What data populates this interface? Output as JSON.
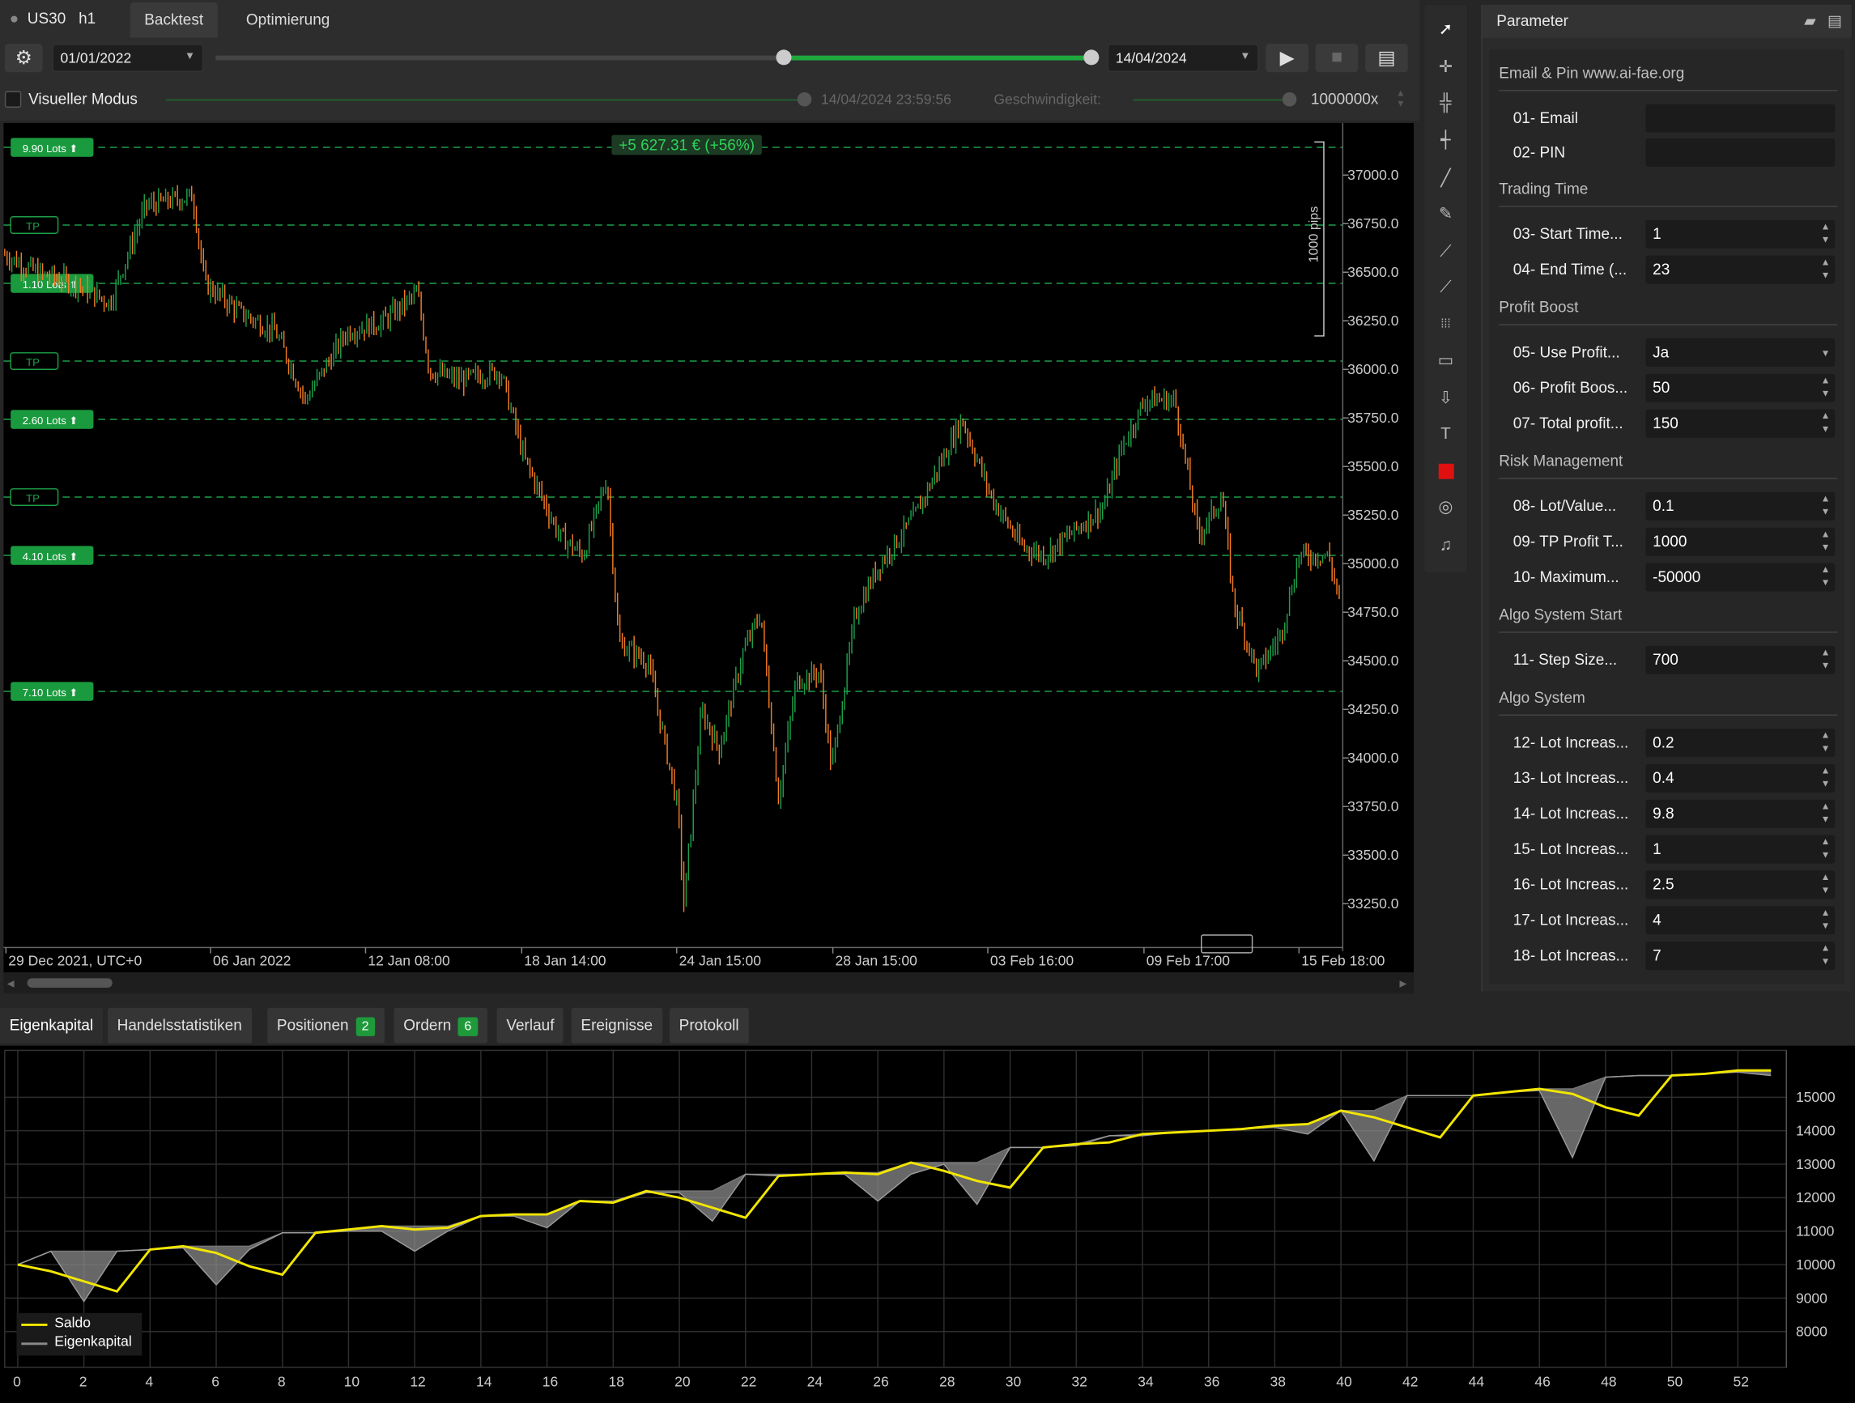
{
  "header": {
    "symbol": "US30",
    "timeframe": "h1",
    "tabs": [
      "Backtest",
      "Optimierung"
    ],
    "active_tab": "Backtest"
  },
  "controls": {
    "start_date": "01/01/2022",
    "end_date": "14/04/2024",
    "progress": 1.0
  },
  "visual": {
    "label": "Visueller Modus",
    "timestamp": "14/04/2024 23:59:56",
    "speed_label": "Geschwindigkeit:",
    "speed_value": "1000000x"
  },
  "chart": {
    "profit_label": "+5 627.31 € (+56%)",
    "pips_label": "1000 pips",
    "price_ticks": [
      "37000.0",
      "36750.0",
      "36500.0",
      "36250.0",
      "36000.0",
      "35750.0",
      "35500.0",
      "35250.0",
      "35000.0",
      "34750.0",
      "34500.0",
      "34250.0",
      "34000.0",
      "33750.0",
      "33500.0",
      "33250.0"
    ],
    "time_ticks": [
      "29 Dec 2021, UTC+0",
      "06 Jan 2022",
      "12 Jan 08:00",
      "18 Jan 14:00",
      "24 Jan 15:00",
      "28 Jan 15:00",
      "03 Feb 16:00",
      "09 Feb 17:00",
      "15 Feb 18:00"
    ],
    "levels": [
      {
        "label": "9.90 Lots ⬆",
        "type": "lot",
        "price": 37100
      },
      {
        "label": "TP",
        "type": "tp",
        "price": 36700
      },
      {
        "label": "1.10 Lots ⬆",
        "type": "lot",
        "price": 36400
      },
      {
        "label": "TP",
        "type": "tp",
        "price": 36000
      },
      {
        "label": "2.60 Lots ⬆",
        "type": "lot",
        "price": 35700
      },
      {
        "label": "TP",
        "type": "tp",
        "price": 35300
      },
      {
        "label": "4.10 Lots ⬆",
        "type": "lot",
        "price": 35000
      },
      {
        "label": "7.10 Lots ⬆",
        "type": "lot",
        "price": 34300
      }
    ],
    "up_color": "#1e9e4a",
    "down_color": "#f07b24"
  },
  "parameter": {
    "title": "Parameter",
    "sections": [
      {
        "title": "Email & Pin www.ai-fae.org",
        "items": [
          {
            "label": "01- Email",
            "value": ""
          },
          {
            "label": "02- PIN",
            "value": ""
          }
        ]
      },
      {
        "title": "Trading Time",
        "items": [
          {
            "label": "03- Start Time...",
            "value": "1"
          },
          {
            "label": "04- End Time (...",
            "value": "23"
          }
        ]
      },
      {
        "title": "Profit Boost",
        "items": [
          {
            "label": "05- Use Profit...",
            "value": "Ja"
          },
          {
            "label": "06- Profit Boos...",
            "value": "50"
          },
          {
            "label": "07- Total profit...",
            "value": "150"
          }
        ]
      },
      {
        "title": "Risk Management",
        "items": [
          {
            "label": "08- Lot/Value...",
            "value": "0.1"
          },
          {
            "label": "09- TP Profit T...",
            "value": "1000"
          },
          {
            "label": "10- Maximum...",
            "value": "-50000"
          }
        ]
      },
      {
        "title": "Algo System Start",
        "items": [
          {
            "label": "11- Step Size...",
            "value": "700"
          }
        ]
      },
      {
        "title": "Algo System",
        "items": [
          {
            "label": "12- Lot Increas...",
            "value": "0.2"
          },
          {
            "label": "13- Lot Increas...",
            "value": "0.4"
          },
          {
            "label": "14- Lot Increas...",
            "value": "9.8"
          },
          {
            "label": "15- Lot Increas...",
            "value": "1"
          },
          {
            "label": "16- Lot Increas...",
            "value": "2.5"
          },
          {
            "label": "17- Lot Increas...",
            "value": "4"
          },
          {
            "label": "18- Lot Increas...",
            "value": "7"
          }
        ]
      }
    ]
  },
  "bottom_tabs": [
    {
      "label": "Eigenkapital"
    },
    {
      "label": "Handelsstatistiken"
    },
    {
      "label": "Positionen",
      "badge": "2"
    },
    {
      "label": "Ordern",
      "badge": "6"
    },
    {
      "label": "Verlauf"
    },
    {
      "label": "Ereignisse"
    },
    {
      "label": "Protokoll"
    }
  ],
  "chart_data": {
    "type": "line",
    "x": [
      0,
      1,
      2,
      3,
      4,
      5,
      6,
      7,
      8,
      9,
      10,
      11,
      12,
      13,
      14,
      15,
      16,
      17,
      18,
      19,
      20,
      21,
      22,
      23,
      24,
      25,
      26,
      27,
      28,
      29,
      30,
      31,
      32,
      33,
      34,
      35,
      36,
      37,
      38,
      39,
      40,
      41,
      42,
      43,
      44,
      45,
      46,
      47,
      48,
      49,
      50,
      51,
      52,
      53
    ],
    "series": [
      {
        "name": "Saldo",
        "values": [
          10000,
          9800,
          9500,
          9200,
          10450,
          10550,
          10350,
          9950,
          9700,
          10950,
          11050,
          11150,
          11050,
          11100,
          11450,
          11500,
          11500,
          11900,
          11850,
          12200,
          12000,
          11700,
          11400,
          12650,
          12700,
          12750,
          12700,
          13050,
          12800,
          12500,
          12300,
          13500,
          13600,
          13650,
          13900,
          13950,
          14000,
          14050,
          14150,
          14200,
          14600,
          14400,
          14100,
          13800,
          15050,
          15150,
          15250,
          15100,
          14700,
          14450,
          15650,
          15700,
          15800,
          15800
        ]
      },
      {
        "name": "Eigenkapital",
        "values": [
          10000,
          10400,
          8900,
          10400,
          10450,
          10500,
          9400,
          10450,
          10950,
          10950,
          11000,
          11000,
          10400,
          11000,
          11450,
          11450,
          11100,
          11900,
          11850,
          12150,
          12150,
          11300,
          12700,
          12650,
          12700,
          12700,
          11900,
          12700,
          13000,
          11800,
          13500,
          13500,
          13550,
          13850,
          13850,
          13950,
          14000,
          14050,
          14100,
          13900,
          14600,
          13100,
          15050,
          15050,
          15050,
          15150,
          15200,
          13200,
          15600,
          15650,
          15650,
          15700,
          15750,
          15650
        ]
      }
    ],
    "xlabel": "",
    "ylabel": "",
    "ylim": [
      7000,
      16400
    ],
    "xlim": [
      0,
      53
    ],
    "yticks": [
      8000,
      9000,
      10000,
      11000,
      12000,
      13000,
      14000,
      15000
    ],
    "xticks": [
      0,
      2,
      4,
      6,
      8,
      10,
      12,
      14,
      16,
      18,
      20,
      22,
      24,
      26,
      28,
      30,
      32,
      34,
      36,
      38,
      40,
      42,
      44,
      46,
      48,
      50,
      52
    ],
    "colors": {
      "Saldo": "#f2e600",
      "Eigenkapital": "#8a8a8a"
    },
    "legend": "bottom-left",
    "grid": true
  }
}
